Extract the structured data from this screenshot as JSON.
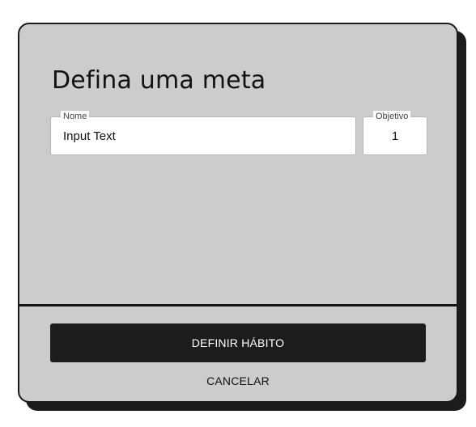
{
  "dialog": {
    "title": "Defina uma meta",
    "fields": {
      "name": {
        "label": "Nome",
        "value": "Input Text"
      },
      "goal": {
        "label": "Objetivo",
        "value": "1"
      }
    },
    "actions": {
      "primary_label": "DEFINIR HÁBITO",
      "secondary_label": "CANCELAR"
    }
  },
  "colors": {
    "dialog_background": "#cccccc",
    "shadow": "#1c1c1c",
    "primary_button": "#1c1c1c",
    "field_background": "#ffffff"
  }
}
